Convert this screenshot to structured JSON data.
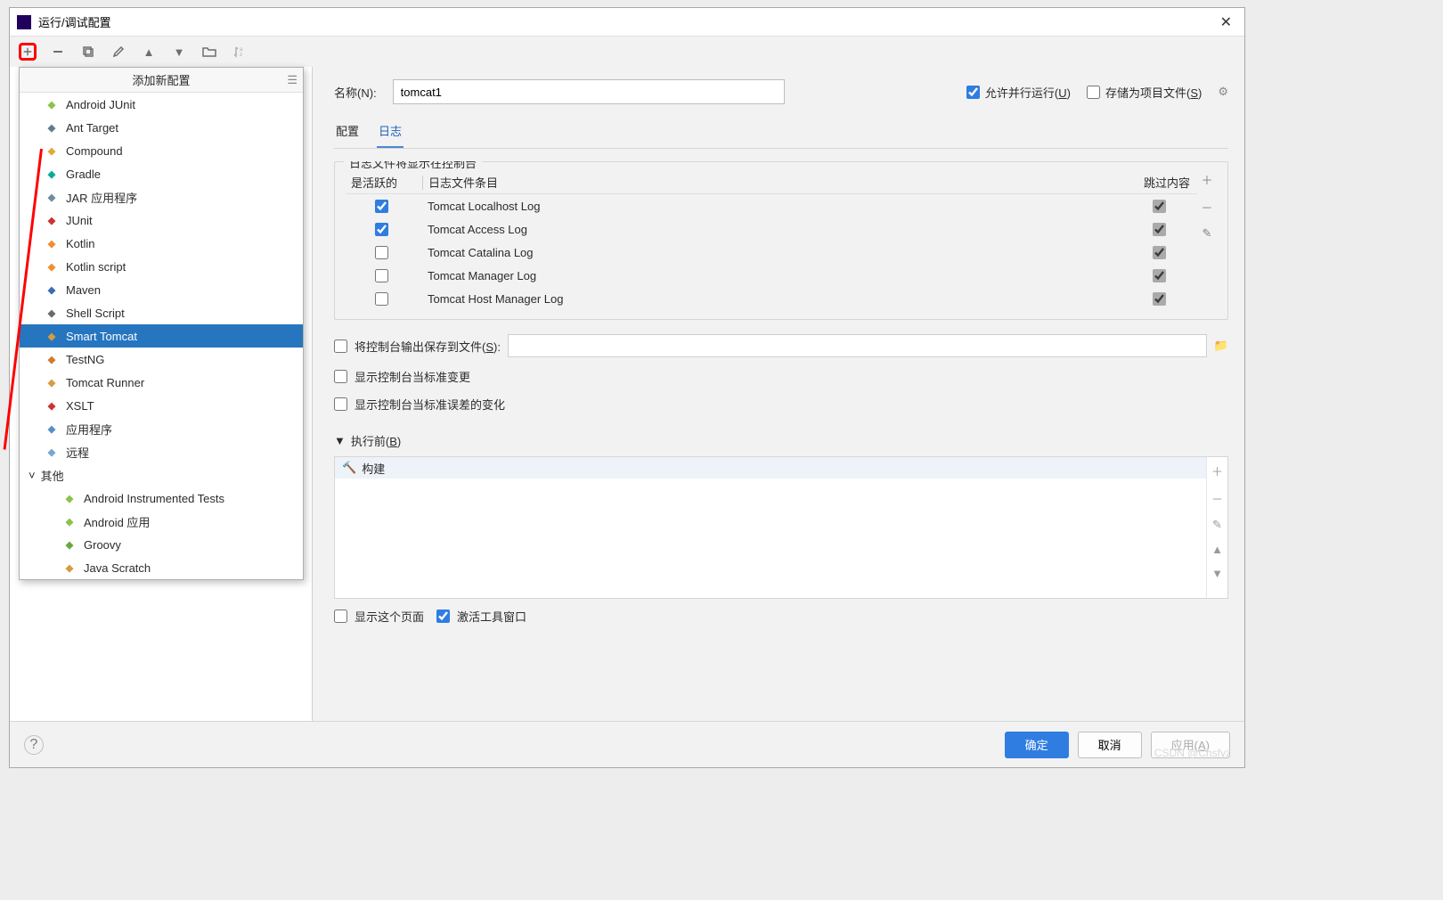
{
  "titlebar": {
    "title": "运行/调试配置"
  },
  "add_popup": {
    "header": "添加新配置",
    "items": [
      {
        "label": "Android JUnit",
        "icon_color": "#8bc34a"
      },
      {
        "label": "Ant Target",
        "icon_color": "#607d8b"
      },
      {
        "label": "Compound",
        "icon_color": "#e2a93a"
      },
      {
        "label": "Gradle",
        "icon_color": "#06a99d"
      },
      {
        "label": "JAR 应用程序",
        "icon_color": "#6b8e9e"
      },
      {
        "label": "JUnit",
        "icon_color": "#cc3333"
      },
      {
        "label": "Kotlin",
        "icon_color": "#f18e33"
      },
      {
        "label": "Kotlin script",
        "icon_color": "#f18e33"
      },
      {
        "label": "Maven",
        "icon_color": "#3b6db5"
      },
      {
        "label": "Shell Script",
        "icon_color": "#6b6b6b"
      },
      {
        "label": "Smart Tomcat",
        "icon_color": "#d79b3f",
        "selected": true
      },
      {
        "label": "TestNG",
        "icon_color": "#d17a2e"
      },
      {
        "label": "Tomcat Runner",
        "icon_color": "#d79b3f"
      },
      {
        "label": "XSLT",
        "icon_color": "#cc3333"
      },
      {
        "label": "应用程序",
        "icon_color": "#5a8fc5"
      },
      {
        "label": "远程",
        "icon_color": "#7aa6cf"
      }
    ],
    "group_label": "其他",
    "other_items": [
      {
        "label": "Android Instrumented Tests",
        "icon_color": "#8bc34a"
      },
      {
        "label": "Android 应用",
        "icon_color": "#8bc34a"
      },
      {
        "label": "Groovy",
        "icon_color": "#69a83e"
      },
      {
        "label": "Java Scratch",
        "icon_color": "#d79b3f"
      }
    ]
  },
  "main": {
    "name_label": "名称(N):",
    "name_value": "tomcat1",
    "allow_parallel": "允许并行运行(U)",
    "store_as_project": "存储为项目文件(S)",
    "tabs": {
      "config": "配置",
      "logs": "日志"
    },
    "logs_fieldset": "日志文件将显示在控制台",
    "log_table": {
      "active_hdr": "是活跃的",
      "entry_hdr": "日志文件条目",
      "skip_hdr": "跳过内容",
      "rows": [
        {
          "active": true,
          "name": "Tomcat Localhost Log",
          "skip": true
        },
        {
          "active": true,
          "name": "Tomcat Access Log",
          "skip": true
        },
        {
          "active": false,
          "name": "Tomcat Catalina Log",
          "skip": true
        },
        {
          "active": false,
          "name": "Tomcat Manager Log",
          "skip": true
        },
        {
          "active": false,
          "name": "Tomcat Host Manager Log",
          "skip": true
        }
      ]
    },
    "save_console": "将控制台输出保存到文件(S):",
    "show_stdout": "显示控制台当标准变更",
    "show_stderr": "显示控制台当标准误差的变化",
    "before_run": "执行前(B)",
    "build_label": "构建",
    "show_page": "显示这个页面",
    "activate_window": "激活工具窗口"
  },
  "footer": {
    "ok": "确定",
    "cancel": "取消",
    "apply": "应用(A)"
  },
  "watermark": "CSDN @Chsfyz"
}
